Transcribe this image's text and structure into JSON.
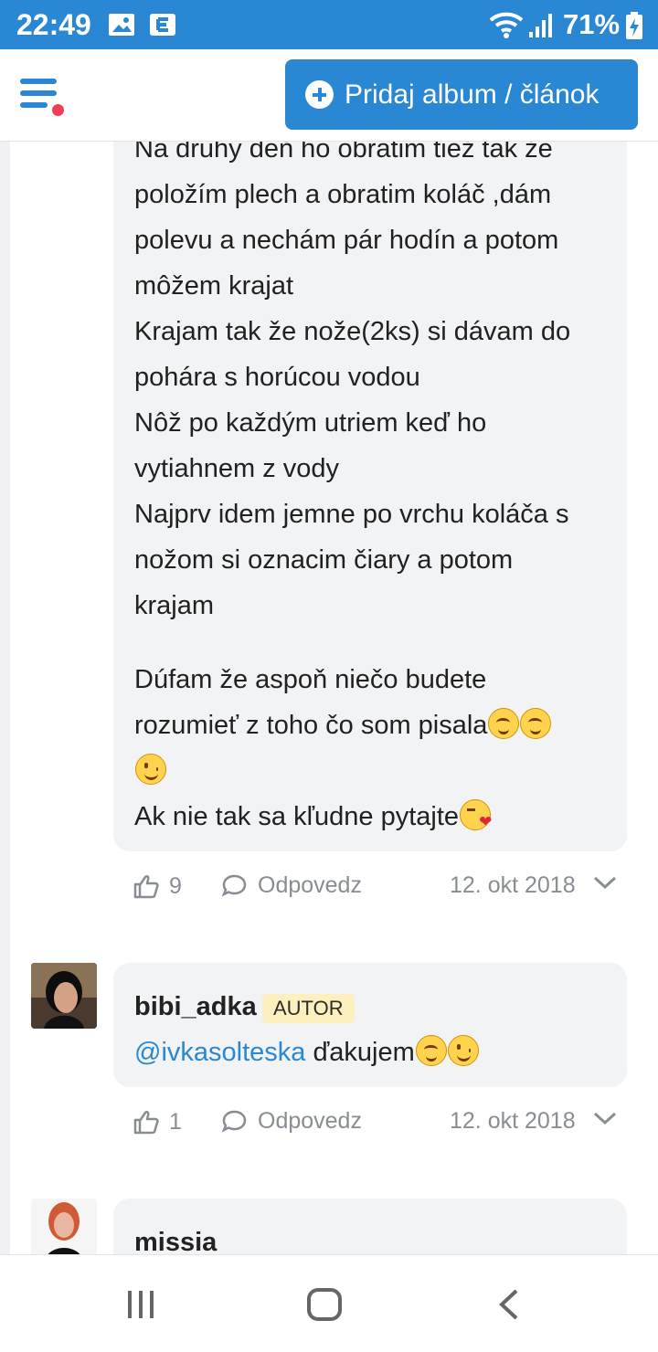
{
  "status_bar": {
    "time": "22:49",
    "battery": "71%",
    "icons": [
      "gallery-icon",
      "e-icon",
      "wifi-icon",
      "signal-icon",
      "battery-charging-icon"
    ]
  },
  "top_bar": {
    "add_button_label": "Pridaj album / článok",
    "menu_icon": "menu-icon",
    "notification_color": "#ef3f55",
    "accent_color": "#2a87d3"
  },
  "comments": [
    {
      "lines": [
        "Na druhý deň ho obratim tiež tak že",
        "položím plech a obratim koláč ,dám",
        "polevu a nechám pár hodín a potom",
        "môžem krajat",
        "Krajam tak že nože(2ks) si dávam do",
        "pohára s horúcou vodou",
        "Nôž po každým utriem keď ho",
        "vytiahnem z vody",
        "Najprv idem jemne po vrchu koláča s",
        "nožom si oznacim čiary a potom",
        "krajam",
        "Dúfam že aspoň niečo budete",
        "rozumieť z toho čo som pisala",
        "Ak nie tak sa kľudne pytajte"
      ],
      "likes": "9",
      "reply_label": "Odpovedz",
      "date": "12. okt 2018"
    },
    {
      "author": "bibi_adka",
      "badge": "AUTOR",
      "mention": "@ivkasolteska",
      "text": " ďakujem",
      "likes": "1",
      "reply_label": "Odpovedz",
      "date": "12. okt 2018"
    },
    {
      "author": "missia"
    }
  ],
  "nav": {
    "icons": [
      "recent-apps-icon",
      "home-icon",
      "back-icon"
    ]
  }
}
